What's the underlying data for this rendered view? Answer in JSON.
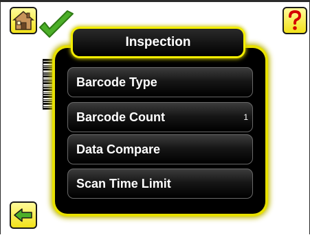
{
  "header": {
    "title": "Inspection"
  },
  "toolbar": {
    "home_icon": "house-icon",
    "status_icon": "green-check-icon",
    "help_icon": "question-mark-icon",
    "back_icon": "back-arrow-icon"
  },
  "menu": {
    "items": [
      {
        "label": "Barcode Type",
        "value": ""
      },
      {
        "label": "Barcode Count",
        "value": "1"
      },
      {
        "label": "Data Compare",
        "value": ""
      },
      {
        "label": "Scan Time Limit",
        "value": ""
      }
    ]
  },
  "colors": {
    "accent_yellow": "#f3ee00",
    "panel_black": "#000000",
    "check_green": "#4caf28"
  }
}
